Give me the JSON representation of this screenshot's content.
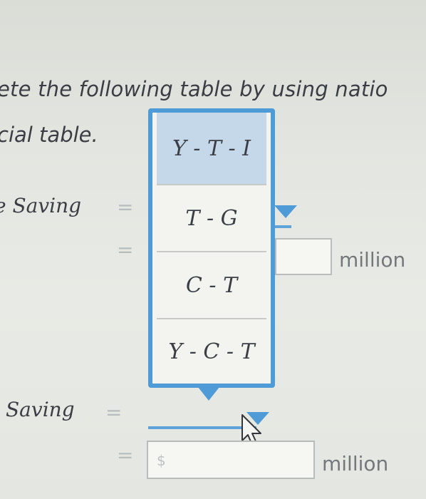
{
  "instructions": {
    "line1": "ete the following table by using natio",
    "line2": "cial table."
  },
  "rows": [
    {
      "label": "e Saving",
      "eq1": "=",
      "eq2": "="
    },
    {
      "label": "Saving",
      "eq1": "=",
      "eq2": "="
    }
  ],
  "dropdown": {
    "options": [
      "Y - T - I",
      "T - G",
      "C - T",
      "Y - C - T"
    ],
    "selected_index": 0
  },
  "inputs": {
    "unit_label": "million",
    "currency_symbol": "$"
  },
  "colors": {
    "accent": "#4f9bd8",
    "selected_bg": "#c4d8ea"
  }
}
